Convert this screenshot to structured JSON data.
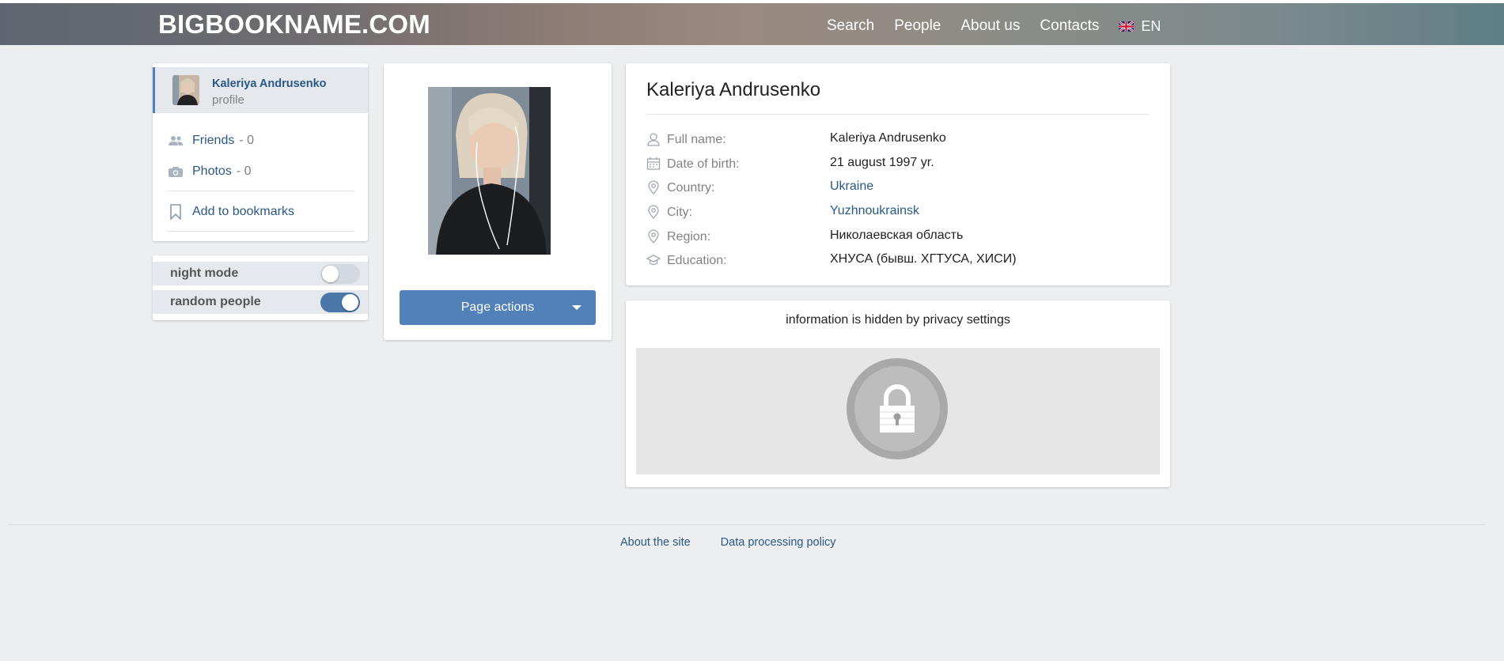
{
  "header": {
    "logo": "BIGBOOKNAME.COM",
    "nav": [
      "Search",
      "People",
      "About us",
      "Contacts"
    ],
    "language": "EN",
    "language_icon": "uk-flag-icon"
  },
  "sidebar": {
    "profile_name": "Kaleriya Andrusenko",
    "profile_sub": "profile",
    "friends_label": "Friends",
    "friends_count": "- 0",
    "photos_label": "Photos",
    "photos_count": "- 0",
    "bookmarks_label": "Add to bookmarks"
  },
  "settings": {
    "night_mode_label": "night mode",
    "night_mode_on": false,
    "random_people_label": "random people",
    "random_people_on": true
  },
  "photo_card": {
    "actions_label": "Page actions"
  },
  "info": {
    "title": "Kaleriya Andrusenko",
    "rows": [
      {
        "icon": "person-icon",
        "label": "Full name:",
        "value": "Kaleriya Andrusenko",
        "link": false
      },
      {
        "icon": "calendar-icon",
        "label": "Date of birth:",
        "value": "21 august 1997 yr.",
        "link": false
      },
      {
        "icon": "location-icon",
        "label": "Country:",
        "value": "Ukraine",
        "link": true
      },
      {
        "icon": "location-icon",
        "label": "City:",
        "value": "Yuzhnoukrainsk",
        "link": true
      },
      {
        "icon": "location-icon",
        "label": "Region:",
        "value": "Николаевская область",
        "link": false
      },
      {
        "icon": "graduation-cap-icon",
        "label": "Education:",
        "value": "ХНУСА (бывш. ХГТУСА, ХИСИ)",
        "link": false
      }
    ]
  },
  "privacy": {
    "text": "information is hidden by privacy settings"
  },
  "footer": {
    "links": [
      "About the site",
      "Data processing policy"
    ]
  }
}
